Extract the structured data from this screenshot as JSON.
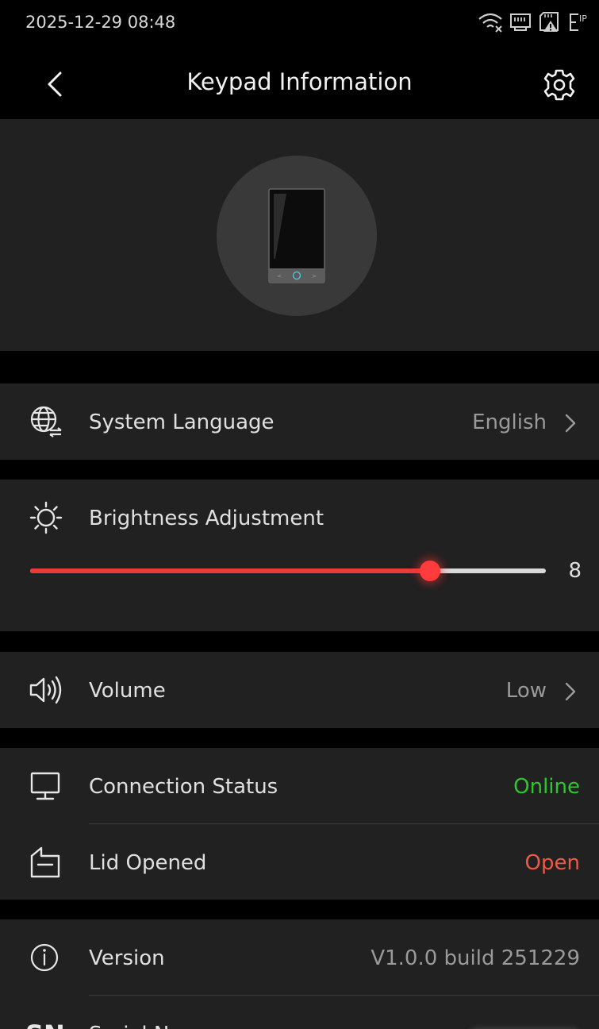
{
  "status": {
    "time": "2025-12-29 08:48",
    "icons": [
      "wifi-disconnected-icon",
      "network-port-icon",
      "sd-card-warning-icon",
      "ip-icon"
    ]
  },
  "header": {
    "title": "Keypad Information",
    "back_icon": "chevron-left-icon",
    "settings_icon": "gear-icon"
  },
  "device": {
    "icon": "keypad-device-icon"
  },
  "system_language": {
    "label": "System Language",
    "value": "English",
    "icon": "globe-language-icon"
  },
  "brightness": {
    "label": "Brightness Adjustment",
    "value": "8",
    "level": 0.775,
    "icon": "sun-icon",
    "accent": "#ea3a3a"
  },
  "volume": {
    "label": "Volume",
    "value": "Low",
    "icon": "speaker-icon"
  },
  "connection": {
    "label": "Connection Status",
    "value": "Online",
    "color": "#2ec52e",
    "icon": "monitor-icon"
  },
  "lid": {
    "label": "Lid Opened",
    "value": "Open",
    "color": "#ec5a4a",
    "icon": "lid-icon"
  },
  "version": {
    "label": "Version",
    "value": "V1.0.0 build 251229",
    "icon": "info-icon"
  },
  "serial": {
    "label": "Serial N",
    "icon_text": "SN"
  }
}
